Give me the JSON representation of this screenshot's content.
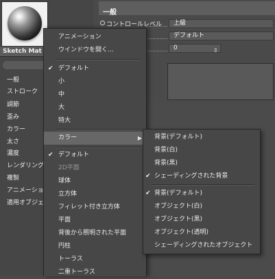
{
  "thumbnail": {
    "material_name": "Sketch Mat"
  },
  "left_panel": {
    "items": [
      "一般",
      "ストローク",
      "調節",
      "歪み",
      "カラー",
      "太さ",
      "濃度",
      "レンダリング",
      "複製",
      "アニメーション",
      "適用オブジェクト"
    ]
  },
  "right_panel": {
    "section_title": "一般",
    "control_level_label": "コントロールレベル",
    "control_level_value": "上級",
    "preset_value": "デフォルト",
    "number_value": "0",
    "spin_icon": "stepper-icon"
  },
  "context_menu": {
    "items": [
      {
        "label": "アニメーション"
      },
      {
        "label": "ウインドウを開く..."
      },
      {
        "label": "デフォルト",
        "checked": true
      },
      {
        "label": "小"
      },
      {
        "label": "中"
      },
      {
        "label": "大"
      },
      {
        "label": "特大"
      },
      {
        "label": "カラー",
        "submenu": true,
        "highlighted": true
      },
      {
        "label": "デフォルト",
        "checked": true
      },
      {
        "label": "2D平面",
        "disabled": true
      },
      {
        "label": "球体"
      },
      {
        "label": "立方体"
      },
      {
        "label": "フィレット付き立方体"
      },
      {
        "label": "平面"
      },
      {
        "label": "背後から照明された平面"
      },
      {
        "label": "円柱"
      },
      {
        "label": "トーラス"
      },
      {
        "label": "二重トーラス"
      }
    ]
  },
  "color_submenu": {
    "items": [
      {
        "label": "背景(デフォルト)"
      },
      {
        "label": "背景(白)"
      },
      {
        "label": "背景(黒)"
      },
      {
        "label": "シェーディングされた背景",
        "checked": true
      },
      {
        "label": "背景(デフォルト)",
        "checked": true
      },
      {
        "label": "オブジェクト(白)"
      },
      {
        "label": "オブジェクト(黒)"
      },
      {
        "label": "オブジェクト(透明)"
      },
      {
        "label": "シェーディングされたオブジェクト"
      }
    ]
  },
  "icons": {
    "check": "✔",
    "submenu_arrow": "▶",
    "stepper": "⇕"
  }
}
